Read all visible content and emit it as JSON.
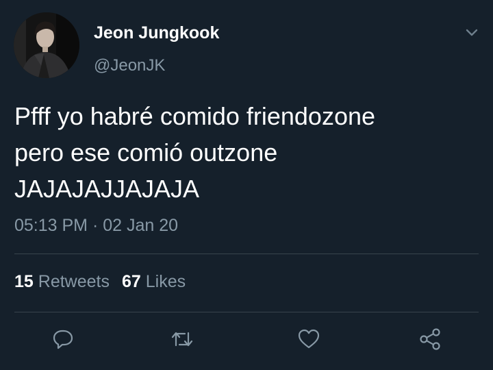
{
  "tweet": {
    "author": {
      "display_name": "Jeon Jungkook",
      "handle": "@JeonJK"
    },
    "text_lines": [
      "Pfff yo habré comido friendozone",
      "pero ese comió outzone",
      "JAJAJAJJAJAJA"
    ],
    "timestamp": "05:13 PM · 02 Jan 20",
    "stats": {
      "retweets_count": "15",
      "retweets_label": "Retweets",
      "likes_count": "67",
      "likes_label": "Likes"
    },
    "actions": {
      "reply_icon": "reply-icon",
      "retweet_icon": "retweet-icon",
      "like_icon": "heart-icon",
      "share_icon": "share-icon"
    }
  },
  "colors": {
    "background": "#15202b",
    "primary_text": "#ffffff",
    "secondary_text": "#8899a6",
    "divider": "#38444d"
  }
}
